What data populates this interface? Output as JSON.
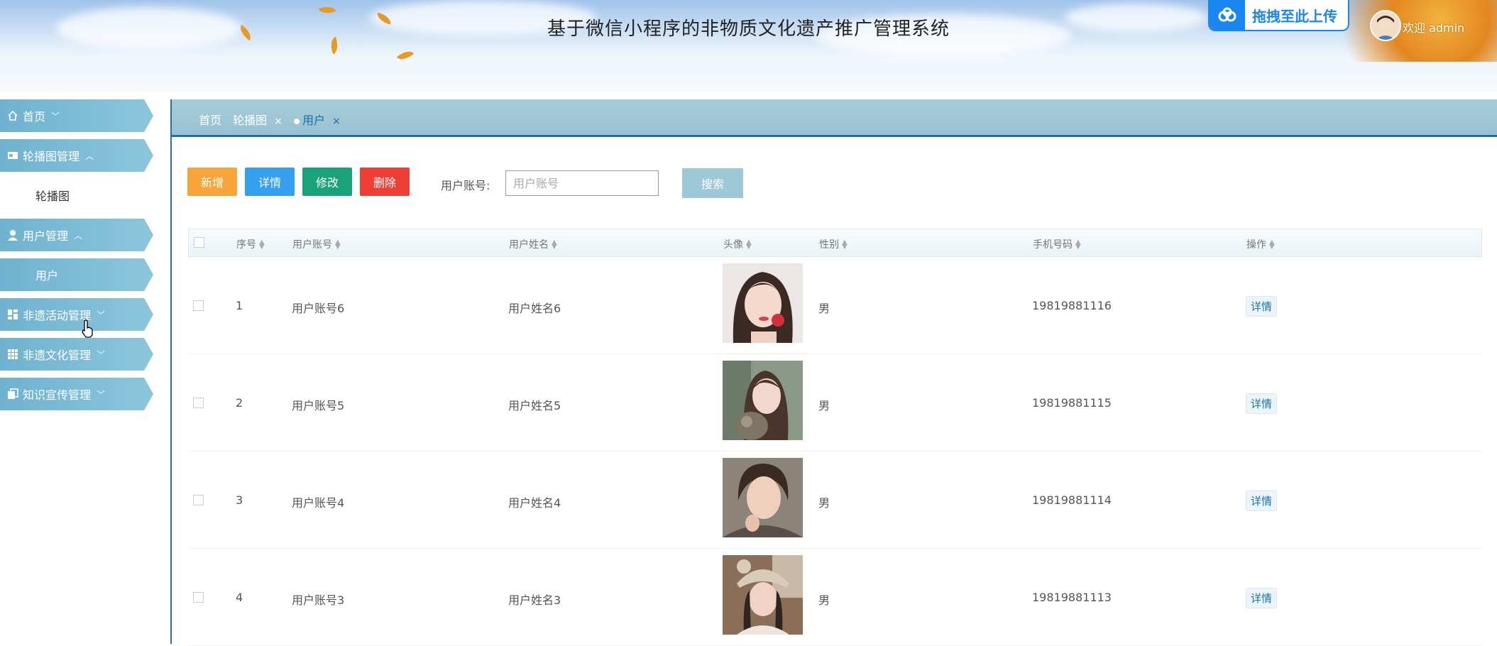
{
  "header": {
    "title": "基于微信小程序的非物质文化遗产推广管理系统",
    "upload_badge": "拖拽至此上传",
    "welcome": "欢迎 admin"
  },
  "sidebar": {
    "items": [
      {
        "label": "首页",
        "icon": "home-icon",
        "chevron": "﹀"
      },
      {
        "label": "轮播图管理",
        "icon": "carousel-icon",
        "chevron": "︿"
      },
      {
        "label": "轮播图",
        "sub": true
      },
      {
        "label": "用户管理",
        "icon": "user-icon",
        "chevron": "︿"
      },
      {
        "label": "用户",
        "sub": true,
        "active": true
      },
      {
        "label": "非遗活动管理",
        "icon": "dashboard-icon",
        "chevron": "﹀"
      },
      {
        "label": "非遗文化管理",
        "icon": "grid-icon",
        "chevron": "﹀"
      },
      {
        "label": "知识宣传管理",
        "icon": "copy-icon",
        "chevron": "﹀"
      }
    ]
  },
  "tabs": [
    {
      "label": "首页"
    },
    {
      "label": "轮播图",
      "close": "×"
    },
    {
      "label": "用户",
      "close": "×",
      "active": true
    }
  ],
  "toolbar": {
    "add": "新增",
    "detail": "详情",
    "edit": "修改",
    "delete": "删除",
    "search_label": "用户账号:",
    "search_placeholder": "用户账号",
    "search_button": "搜索",
    "colors": {
      "add": "#f7a53a",
      "detail": "#35a0ef",
      "edit": "#1aa37a",
      "delete": "#ee3f36"
    }
  },
  "table": {
    "columns": [
      "序号",
      "用户账号",
      "用户姓名",
      "头像",
      "性别",
      "手机号码",
      "操作"
    ],
    "rows": [
      {
        "index": "1",
        "account": "用户账号6",
        "name": "用户姓名6",
        "gender": "男",
        "phone": "19819881116",
        "action": "详情"
      },
      {
        "index": "2",
        "account": "用户账号5",
        "name": "用户姓名5",
        "gender": "男",
        "phone": "19819881115",
        "action": "详情"
      },
      {
        "index": "3",
        "account": "用户账号4",
        "name": "用户姓名4",
        "gender": "男",
        "phone": "19819881114",
        "action": "详情"
      },
      {
        "index": "4",
        "account": "用户账号3",
        "name": "用户姓名3",
        "gender": "男",
        "phone": "19819881113",
        "action": "详情"
      }
    ]
  }
}
